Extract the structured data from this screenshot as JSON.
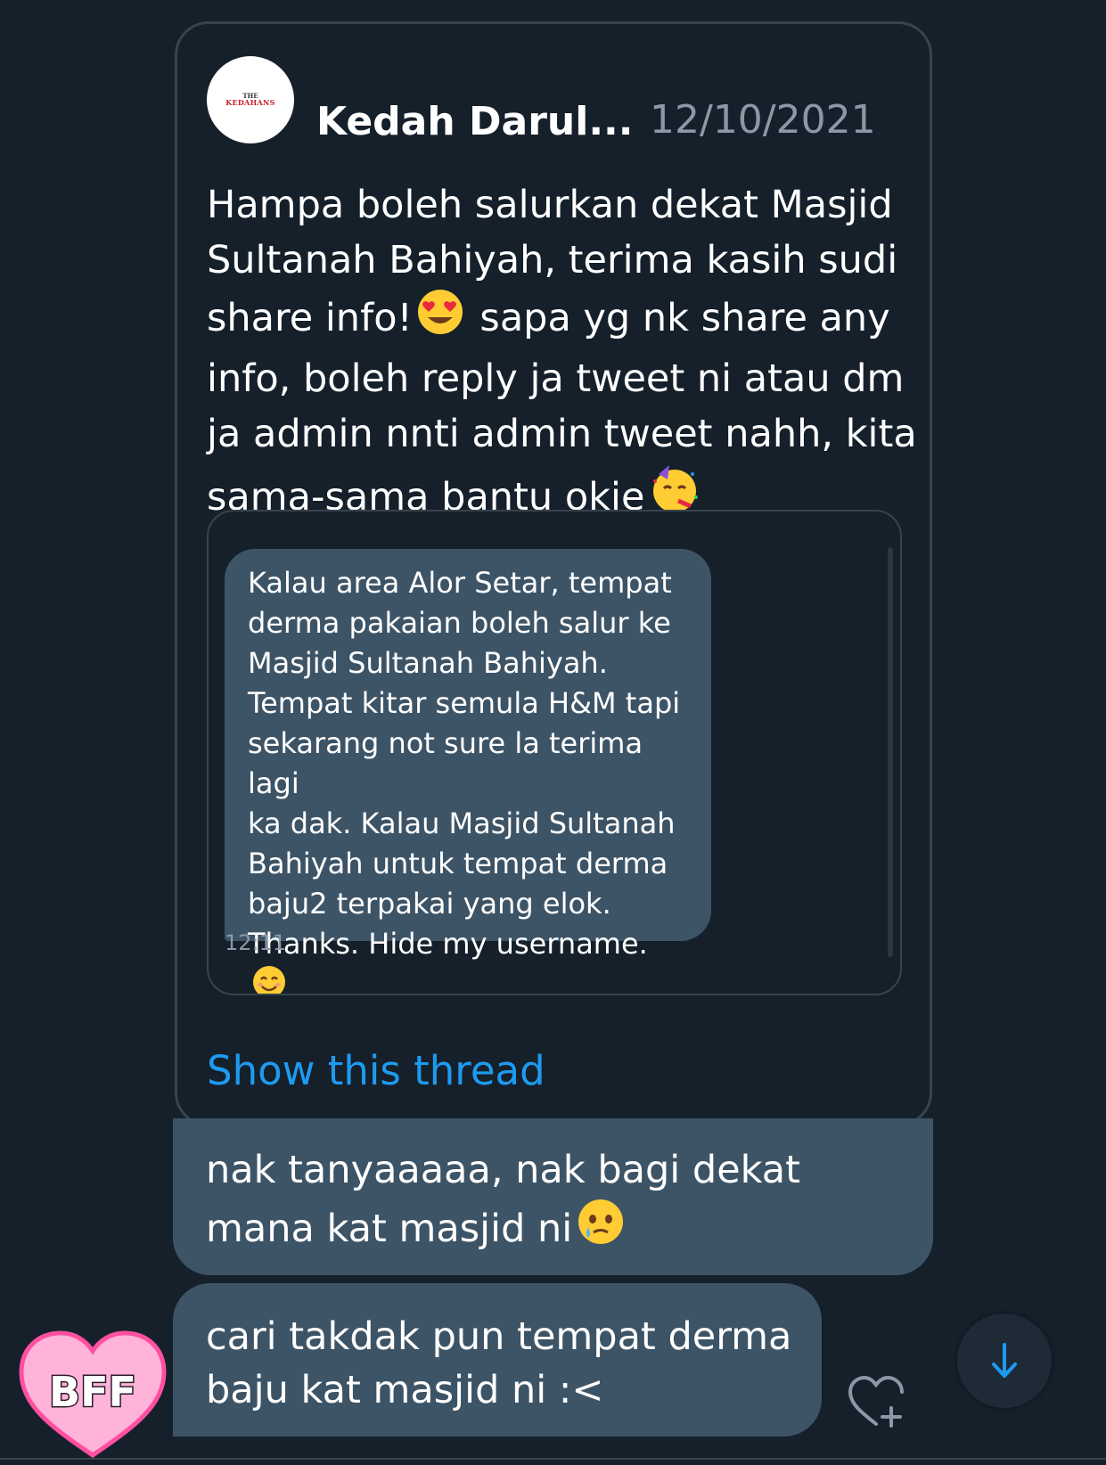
{
  "tweet": {
    "author": "Kedah Darul...",
    "date": "12/10/2021",
    "avatar_logo_top": "THE",
    "avatar_logo_main": "KEDAHANS",
    "text_part1": "Hampa boleh salurkan dekat Masjid Sultanah Bahiyah, terima kasih sudi share info!",
    "text_part2": "sapa yg nk share any info, boleh reply ja tweet ni atau dm ja admin nnti admin tweet nahh, kita sama-sama bantu okie",
    "emoji_1": "heart-eyes-emoji",
    "emoji_2": "party-face-emoji",
    "media": {
      "dm_text": "Kalau area Alor Setar, tempat\nderma pakaian boleh salur ke\nMasjid Sultanah Bahiyah.\nTempat kitar semula H&M tapi\nsekarang not sure la terima lagi\nka dak. Kalau Masjid Sultanah\nBahiyah untuk tempat derma\nbaju2 terpakai yang elok.\nThanks. Hide my username.",
      "dm_emoji": "smiling-face-emoji",
      "dm_time": "12:11"
    },
    "show_thread": "Show this thread"
  },
  "messages": [
    {
      "text": "nak tanyaaaaa, nak bagi dekat\nmana kat masjid ni",
      "emoji": "face-holding-back-tears-emoji"
    },
    {
      "text": "cari takdak pun tempat derma\nbaju kat masjid ni :<"
    }
  ],
  "sticker": {
    "label": "BFF"
  },
  "icons": {
    "scroll_down": "arrow-down-icon",
    "react": "heart-plus-icon"
  },
  "colors": {
    "background": "#15202b",
    "bubble": "#3d5466",
    "accent": "#1d9bf0",
    "muted": "#8b98a5",
    "border": "#38444d"
  }
}
